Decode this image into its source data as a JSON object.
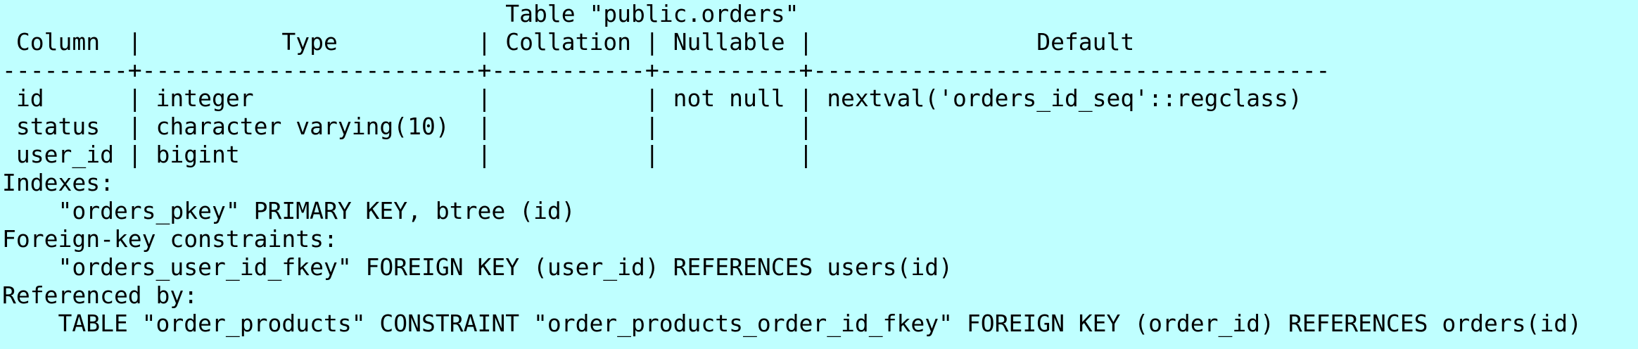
{
  "terminal": {
    "lines": [
      "                                    Table \"public.orders\"",
      " Column  |          Type          | Collation | Nullable |                Default",
      "---------+------------------------+-----------+----------+-------------------------------------",
      " id      | integer                |           | not null | nextval('orders_id_seq'::regclass)",
      " status  | character varying(10)  |           |          |",
      " user_id | bigint                 |           |          |",
      "Indexes:",
      "    \"orders_pkey\" PRIMARY KEY, btree (id)",
      "Foreign-key constraints:",
      "    \"orders_user_id_fkey\" FOREIGN KEY (user_id) REFERENCES users(id)",
      "Referenced by:",
      "    TABLE \"order_products\" CONSTRAINT \"order_products_order_id_fkey\" FOREIGN KEY (order_id) REFERENCES orders(id)"
    ]
  }
}
